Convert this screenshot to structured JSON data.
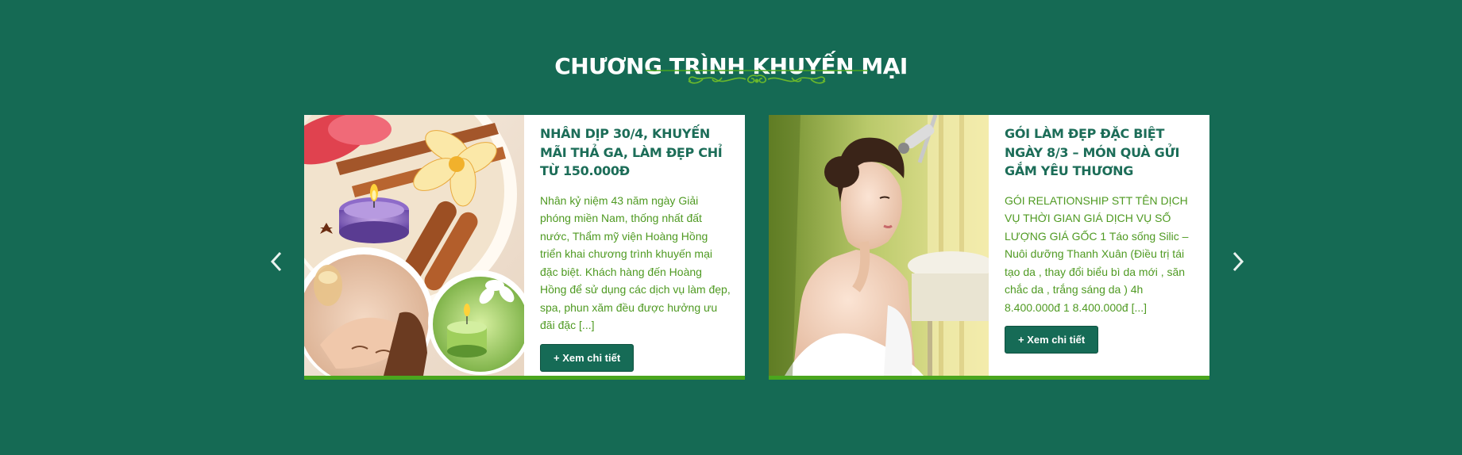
{
  "section": {
    "title": "CHƯƠNG TRÌNH KHUYẾN MẠI"
  },
  "carousel": {
    "prev_icon": "chevron-left-icon",
    "next_icon": "chevron-right-icon",
    "items": [
      {
        "title": "NHÂN DỊP 30/4, KHUYẾN MÃI THẢ GA, LÀM ĐẸP CHỈ TỪ 150.000Đ",
        "excerpt": "Nhân kỷ niệm 43 năm ngày Giải phóng miền Nam, thống nhất đất nước, Thẩm mỹ viện Hoàng Hồng triển khai chương trình khuyến mại đặc biệt. Khách hàng đến Hoàng Hồng để sử dụng các dịch vụ làm đẹp, spa, phun xăm đều được hưởng ưu đãi đặc [...]",
        "button_label": "+ Xem chi tiết"
      },
      {
        "title": "GÓI LÀM ĐẸP ĐẶC BIỆT NGÀY 8/3 – MÓN QUÀ GỬI GẮM YÊU THƯƠNG",
        "excerpt": "GÓI RELATIONSHIP STT TÊN DỊCH VỤ THỜI GIAN GIÁ DỊCH VỤ SỐ LƯỢNG GIÁ GỐC 1 Táo sống Silic – Nuôi dưỡng Thanh Xuân (Điều trị tái tạo da , thay đổi biểu bì da mới , săn chắc da , trắng sáng da ) 4h 8.400.000đ 1 8.400.000đ [...]",
        "button_label": "+ Xem chi tiết"
      }
    ]
  },
  "colors": {
    "background": "#156a54",
    "title_green": "#1c6d58",
    "text_green": "#4f9a22",
    "accent_bar": "#4aa61e",
    "button_bg": "#166b56"
  }
}
